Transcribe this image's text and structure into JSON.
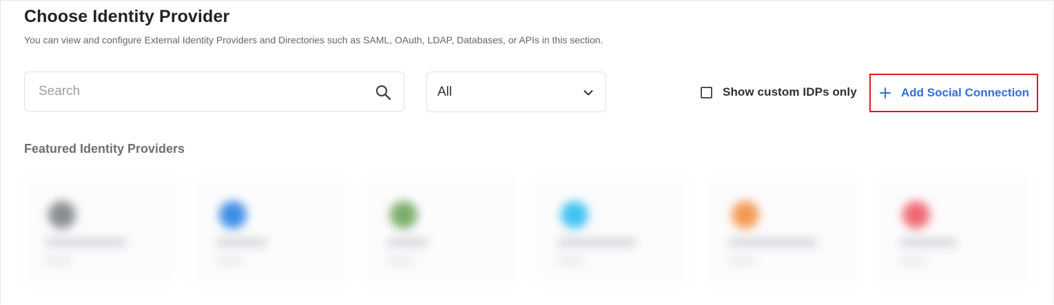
{
  "header": {
    "title": "Choose Identity Provider",
    "subtitle": "You can view and configure External Identity Providers and Directories such as SAML, OAuth, LDAP, Databases, or APIs in this section."
  },
  "search": {
    "placeholder": "Search",
    "value": "",
    "icon": "search-icon"
  },
  "filter": {
    "selected": "All",
    "icon": "chevron-down-icon"
  },
  "custom_idps_toggle": {
    "label": "Show custom IDPs only",
    "checked": false
  },
  "add_social_connection": {
    "label": "Add Social Connection",
    "icon": "plus-icon",
    "highlight_color": "#e0141b",
    "text_color": "#2f6fdb"
  },
  "featured": {
    "heading": "Featured Identity Providers",
    "cards": [
      {
        "logo_color": "#8a8d91"
      },
      {
        "logo_color": "#3f8ee6"
      },
      {
        "logo_color": "#7cae6a"
      },
      {
        "logo_color": "#42c3f0"
      },
      {
        "logo_color": "#f39a55"
      },
      {
        "logo_color": "#f06b73"
      }
    ]
  }
}
